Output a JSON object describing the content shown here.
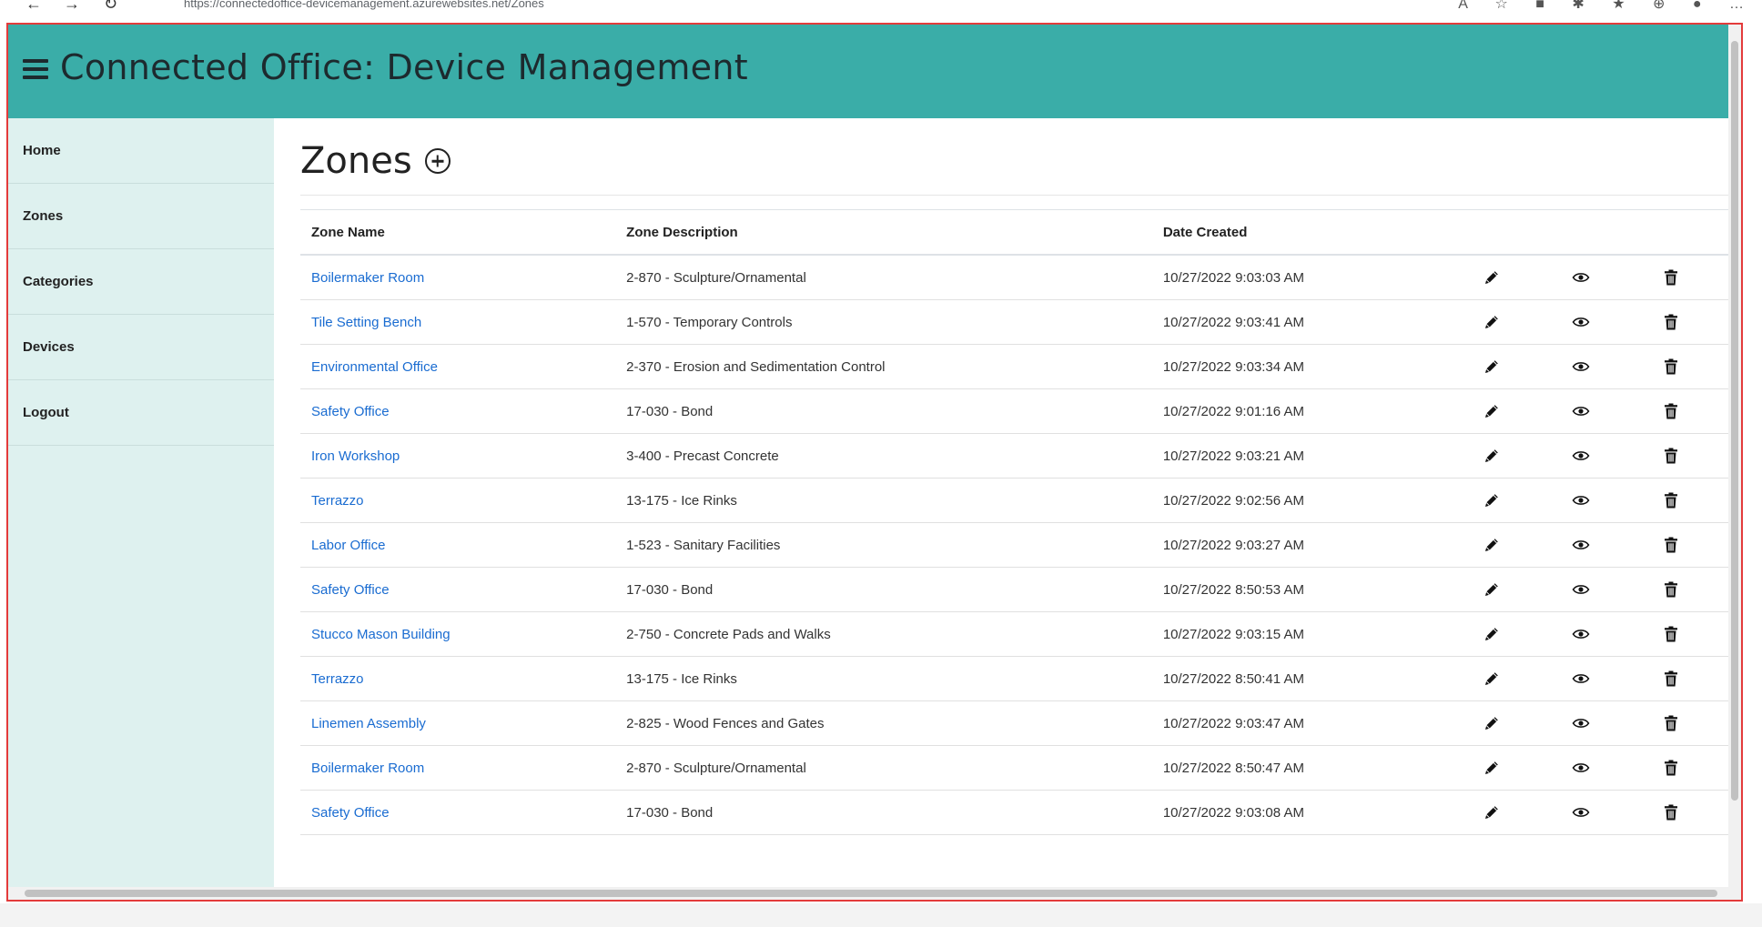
{
  "browser": {
    "url": "https://connectedoffice-devicemanagement.azurewebsites.net/Zones",
    "back_icon": "arrow-left-icon",
    "forward_icon": "arrow-right-icon",
    "reload_icon": "reload-icon"
  },
  "header": {
    "title": "Connected Office: Device Management",
    "background": "#3aada8"
  },
  "sidebar": {
    "background": "#def1ef",
    "items": [
      {
        "label": "Home"
      },
      {
        "label": "Zones"
      },
      {
        "label": "Categories"
      },
      {
        "label": "Devices"
      },
      {
        "label": "Logout"
      }
    ]
  },
  "main": {
    "heading": "Zones",
    "add_icon": "plus-circle-icon",
    "table": {
      "columns": [
        "Zone Name",
        "Zone Description",
        "Date Created"
      ],
      "link_color": "#1a6cd1",
      "rows": [
        {
          "name": "Boilermaker Room",
          "description": "2-870 - Sculpture/Ornamental",
          "date": "10/27/2022 9:03:03 AM"
        },
        {
          "name": "Tile Setting Bench",
          "description": "1-570 - Temporary Controls",
          "date": "10/27/2022 9:03:41 AM"
        },
        {
          "name": "Environmental Office",
          "description": "2-370 - Erosion and Sedimentation Control",
          "date": "10/27/2022 9:03:34 AM"
        },
        {
          "name": "Safety Office",
          "description": "17-030 - Bond",
          "date": "10/27/2022 9:01:16 AM"
        },
        {
          "name": "Iron Workshop",
          "description": "3-400 - Precast Concrete",
          "date": "10/27/2022 9:03:21 AM"
        },
        {
          "name": "Terrazzo",
          "description": "13-175 - Ice Rinks",
          "date": "10/27/2022 9:02:56 AM"
        },
        {
          "name": "Labor Office",
          "description": "1-523 - Sanitary Facilities",
          "date": "10/27/2022 9:03:27 AM"
        },
        {
          "name": "Safety Office",
          "description": "17-030 - Bond",
          "date": "10/27/2022 8:50:53 AM"
        },
        {
          "name": "Stucco Mason Building",
          "description": "2-750 - Concrete Pads and Walks",
          "date": "10/27/2022 9:03:15 AM"
        },
        {
          "name": "Terrazzo",
          "description": "13-175 - Ice Rinks",
          "date": "10/27/2022 8:50:41 AM"
        },
        {
          "name": "Linemen Assembly",
          "description": "2-825 - Wood Fences and Gates",
          "date": "10/27/2022 9:03:47 AM"
        },
        {
          "name": "Boilermaker Room",
          "description": "2-870 - Sculpture/Ornamental",
          "date": "10/27/2022 8:50:47 AM"
        },
        {
          "name": "Safety Office",
          "description": "17-030 - Bond",
          "date": "10/27/2022 9:03:08 AM"
        }
      ],
      "row_actions": [
        "pencil-icon",
        "eye-icon",
        "trash-icon"
      ]
    }
  }
}
